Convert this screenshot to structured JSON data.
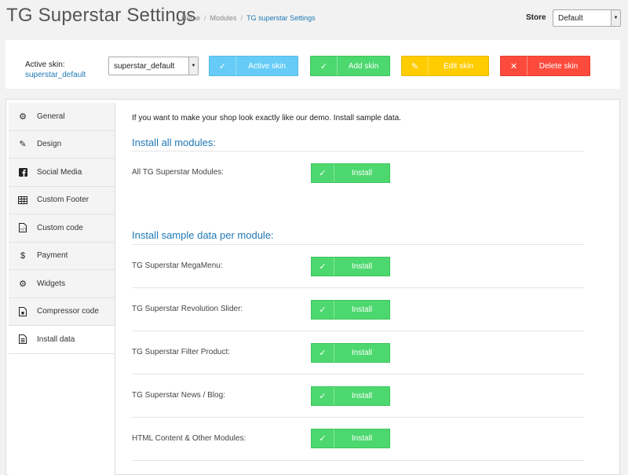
{
  "header": {
    "title": "TG Superstar Settings",
    "breadcrumbs": [
      "Home",
      "Modules",
      "TG superstar Settings"
    ],
    "store_label": "Store",
    "store_value": "Default"
  },
  "skin": {
    "label": "Active skin:",
    "value": "superstar_default",
    "select_value": "superstar_default",
    "buttons": {
      "active": "Active skin",
      "add": "Add skin",
      "edit": "Edit skin",
      "delete": "Delete skin"
    }
  },
  "sidebar": {
    "items": [
      {
        "label": "General",
        "icon": "gear-icon"
      },
      {
        "label": "Design",
        "icon": "pencil-icon"
      },
      {
        "label": "Social Media",
        "icon": "facebook-icon"
      },
      {
        "label": "Custom Footer",
        "icon": "table-icon"
      },
      {
        "label": "Custom code",
        "icon": "code-file-icon"
      },
      {
        "label": "Payment",
        "icon": "dollar-icon"
      },
      {
        "label": "Widgets",
        "icon": "cogs-icon"
      },
      {
        "label": "Compressor code",
        "icon": "file-zip-icon"
      },
      {
        "label": "Install data",
        "icon": "document-icon"
      }
    ]
  },
  "content": {
    "intro": "If you want to make your shop look exactly like our demo. Install sample data.",
    "section_all": "Install all modules:",
    "all_label": "All TG Superstar Modules:",
    "section_per_module": "Install sample data per module:",
    "modules": [
      "TG Superstar MegaMenu:",
      "TG Superstar Revolution Slider:",
      "TG Superstar Filter Product:",
      "TG Superstar News / Blog:",
      "HTML Content & Other Modules:"
    ],
    "install_label": "Install"
  },
  "colors": {
    "accent_blue": "#1e78b4",
    "active_skin_btn": "#66ccf7",
    "add_btn": "#4cd86e",
    "edit_btn": "#ffcc00",
    "delete_btn": "#fc4b3c"
  }
}
